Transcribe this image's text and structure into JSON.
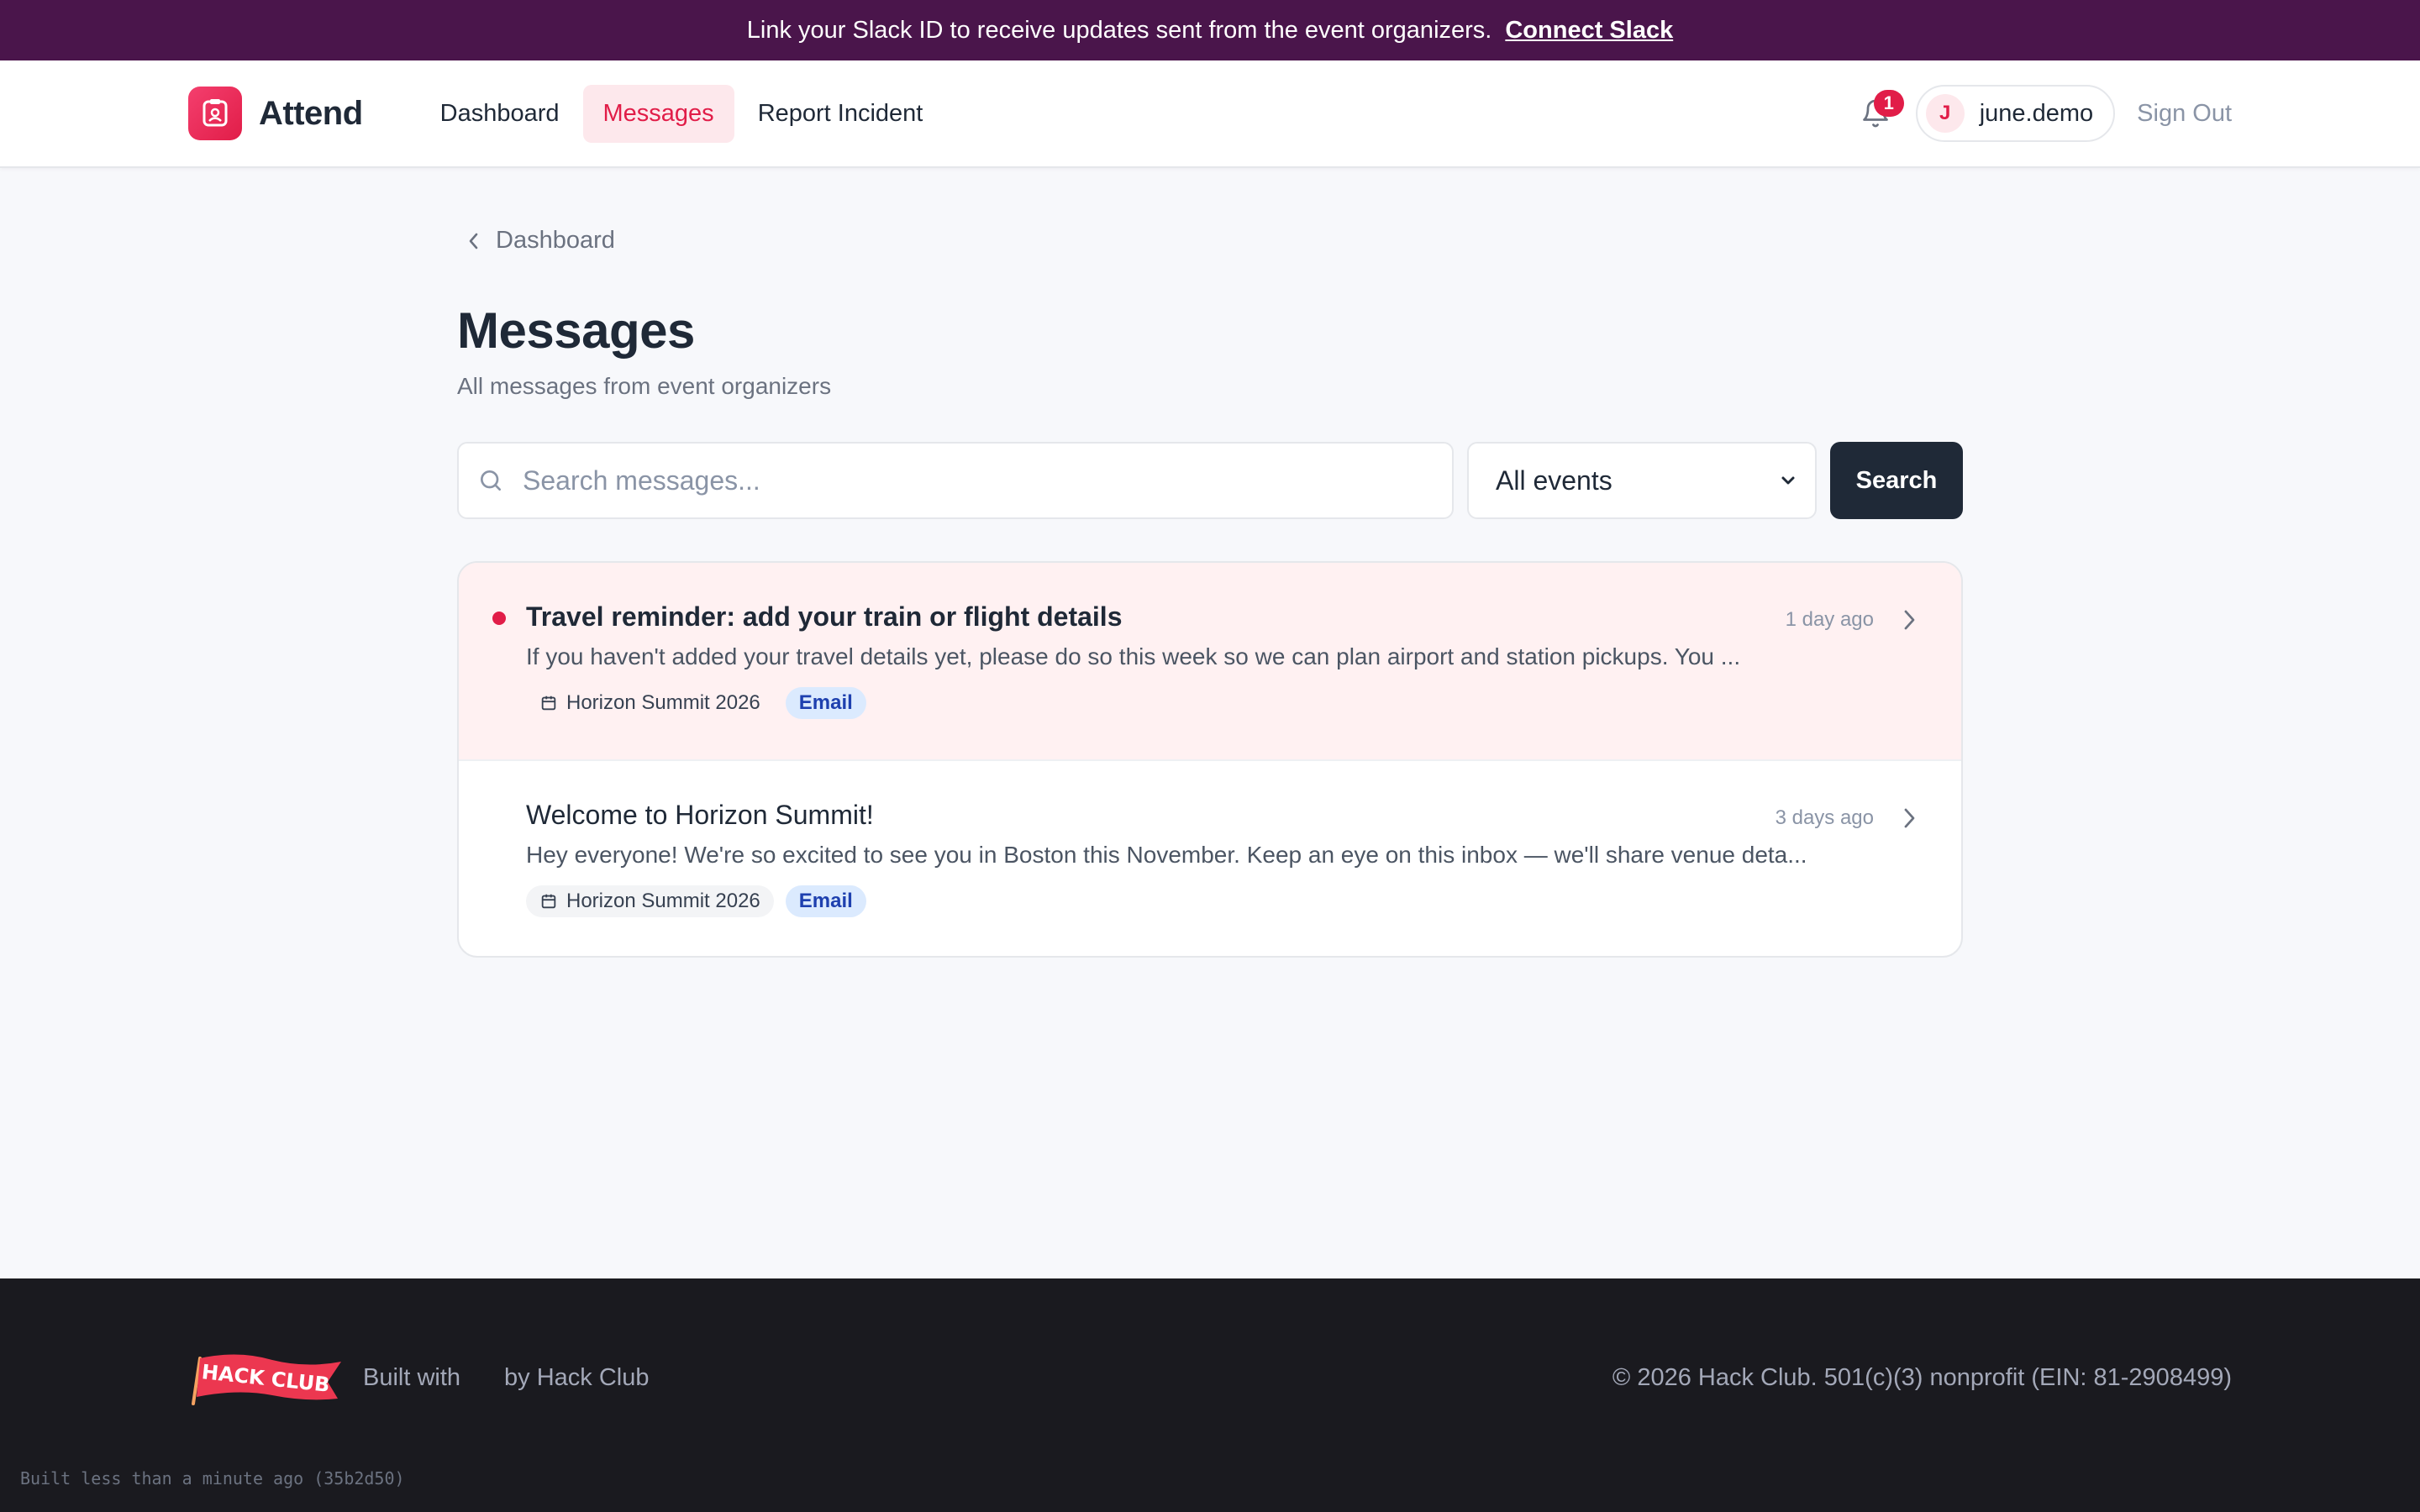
{
  "banner": {
    "text": "Link your Slack ID to receive updates sent from the event organizers.",
    "link_label": "Connect Slack",
    "bg_color": "#4a154b"
  },
  "header": {
    "brand": "Attend",
    "nav": [
      {
        "label": "Dashboard",
        "active": false
      },
      {
        "label": "Messages",
        "active": true
      },
      {
        "label": "Report Incident",
        "active": false
      }
    ],
    "notifications_count": "1",
    "user_initial": "J",
    "username": "june.demo",
    "sign_out": "Sign Out",
    "accent_color": "#e11d48"
  },
  "breadcrumb": {
    "label": "Dashboard"
  },
  "page": {
    "title": "Messages",
    "subtitle": "All messages from event organizers"
  },
  "search": {
    "placeholder": "Search messages...",
    "value": "",
    "filter_selected": "All events",
    "button_label": "Search"
  },
  "messages": [
    {
      "title": "Travel reminder: add your train or flight details",
      "time": "1 day ago",
      "preview": "If you haven't added your travel details yet, please do so this week so we can plan airport and station pickups. You ...",
      "event": "Horizon Summit 2026",
      "channel": "Email",
      "unread": true
    },
    {
      "title": "Welcome to Horizon Summit!",
      "time": "3 days ago",
      "preview": "Hey everyone! We're so excited to see you in Boston this November. Keep an eye on this inbox — we'll share venue deta...",
      "event": "Horizon Summit 2026",
      "channel": "Email",
      "unread": false
    }
  ],
  "footer": {
    "logo_text": "HACK CLUB",
    "built_with": "Built with",
    "by": "by Hack Club",
    "copyright": "© 2026 Hack Club. 501(c)(3) nonprofit (EIN: 81-2908499)",
    "build_info": "Built less than a minute ago (35b2d50)"
  }
}
